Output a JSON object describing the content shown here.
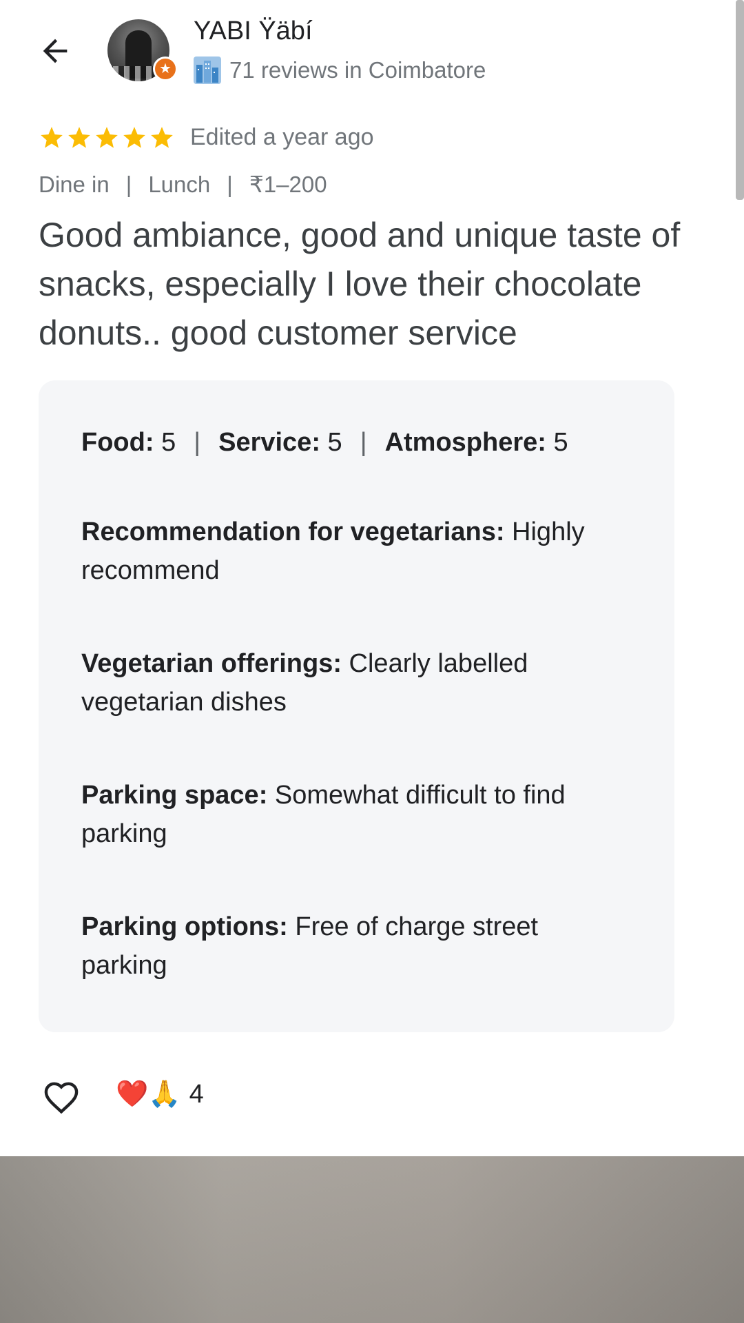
{
  "header": {
    "user_name": "YABI Ÿäbí",
    "user_meta": "71 reviews in Coimbatore",
    "city_icon": "city-buildings-icon",
    "badge_icon": "local-guide-star-icon"
  },
  "rating": {
    "stars": 5,
    "time": "Edited a year ago"
  },
  "tags": [
    "Dine in",
    "Lunch",
    "₹1–200"
  ],
  "review_text": "Good ambiance, good and unique taste of snacks, especially I love their chocolate donuts.. good customer service",
  "attributes": {
    "scores": [
      {
        "label": "Food:",
        "value": "5"
      },
      {
        "label": "Service:",
        "value": "5"
      },
      {
        "label": "Atmosphere:",
        "value": "5"
      }
    ],
    "items": [
      {
        "label": "Recommendation for vegetarians:",
        "value": "Highly recommend"
      },
      {
        "label": "Vegetarian offerings:",
        "value": "Clearly labelled vegetarian dishes"
      },
      {
        "label": "Parking space:",
        "value": "Somewhat difficult to find parking"
      },
      {
        "label": "Parking options:",
        "value": "Free of charge street parking"
      }
    ]
  },
  "reactions": {
    "emojis": "❤️🙏",
    "count": "4"
  },
  "colors": {
    "star": "#fbbc04",
    "badge": "#e8711a",
    "muted_text": "#70757a",
    "box_bg": "#f5f6f8"
  }
}
